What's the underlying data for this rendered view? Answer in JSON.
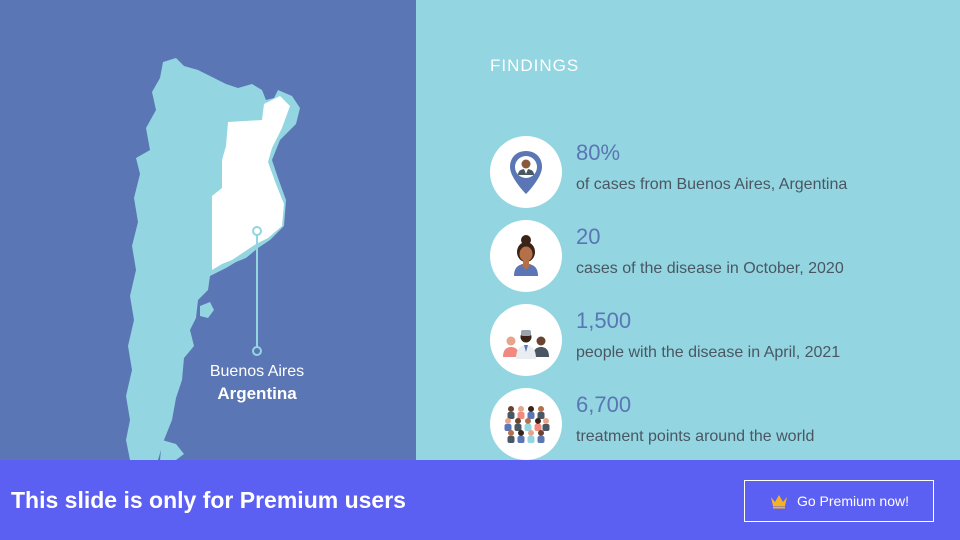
{
  "map": {
    "city": "Buenos Aires",
    "country": "Argentina",
    "colors": {
      "background": "#5a76b4",
      "land": "#93d5e0",
      "province": "#ffffff"
    }
  },
  "findings": {
    "title": "FINDINGS",
    "items": [
      {
        "value": "80%",
        "description": "of cases from Buenos Aires, Argentina",
        "icon": "location-pin-person-icon"
      },
      {
        "value": "20",
        "description": "cases of the disease in October, 2020",
        "icon": "woman-avatar-icon"
      },
      {
        "value": "1,500",
        "description": "people with the disease in April, 2021",
        "icon": "group-people-icon"
      },
      {
        "value": "6,700",
        "description": "treatment points around the world",
        "icon": "crowd-icon"
      }
    ]
  },
  "premium": {
    "message": "This slide is only for Premium users",
    "button_label": "Go Premium now!",
    "button_icon": "crown-icon",
    "color": "#5b5ff2"
  }
}
